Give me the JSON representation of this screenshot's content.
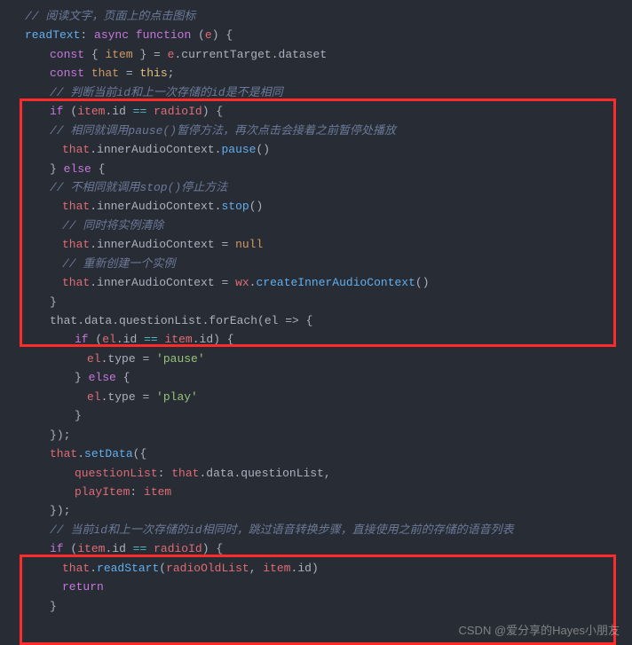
{
  "code": {
    "c_top": "// 阅读文字，页面上的点击图标",
    "fn_name": "readText",
    "kw_async": "async",
    "kw_function": "function",
    "param": "e",
    "brace_open": "{",
    "brace_close": "}",
    "l_const1_a": "const",
    "l_const1_b": "{ ",
    "l_const1_item": "item",
    "l_const1_c": " } = ",
    "l_const1_e": "e",
    "l_const1_d": ".",
    "l_const1_ct": "currentTarget",
    "l_const1_ds": "dataset",
    "l_const2_a": "const",
    "l_const2_that": "that",
    "l_const2_eq": " = ",
    "l_const2_this": "this",
    "semi": ";",
    "c_b1": "// 判断当前id和上一次存储的id是不是相同",
    "kw_if": "if",
    "paren_o": "(",
    "paren_c": ")",
    "item": "item",
    "dot": ".",
    "id": "id",
    "eqeq": " == ",
    "radioId": "radioId",
    "c_b2": "// 相同就调用pause()暂停方法，再次点击会接着之前暂停处播放",
    "that": "that",
    "iac": "innerAudioContext",
    "pause": "pause",
    "empty_call": "()",
    "kw_else": "else",
    "c_b3": "// 不相同就调用stop()停止方法",
    "stop": "stop",
    "c_b4": "// 同时将实例清除",
    "eq": " = ",
    "null": "null",
    "c_b5": "// 重新创建一个实例",
    "wx": "wx",
    "ciac": "createInnerAudioContext",
    "foreach_line": "that.data.questionList.forEach(el => {",
    "el": "el",
    "type": "type",
    "str_pause": "'pause'",
    "str_play": "'play'",
    "close_paren_semi": ");",
    "setData": "setData",
    "ql": "questionList",
    "data": "data",
    "comma": ",",
    "playItem": "playItem",
    "close_obj_paren_semi": ");",
    "c_b6": "// 当前id和上一次存储的id相同时，跳过语音转换步骤，直接使用之前的存储的语音列表",
    "readStart": "readStart",
    "radioOldList": "radioOldList",
    "comma_sp": ", ",
    "kw_return": "return"
  },
  "watermark": "CSDN @爱分享的Hayes小朋友"
}
